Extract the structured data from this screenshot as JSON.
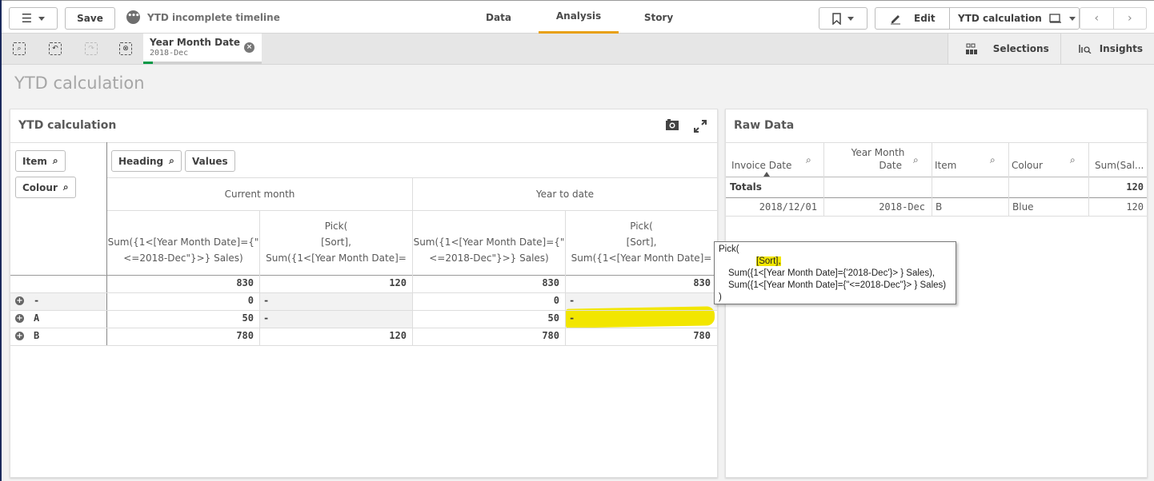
{
  "toolbar": {
    "save_label": "Save",
    "app_title": "YTD incomplete timeline",
    "tabs": [
      {
        "label": "Data"
      },
      {
        "label": "Analysis",
        "active": true
      },
      {
        "label": "Story"
      }
    ],
    "edit_label": "Edit",
    "sheet_name": "YTD calculation",
    "accent_color": "#e8a013"
  },
  "selections_bar": {
    "chip": {
      "field": "Year Month Date",
      "value": "2018-Dec",
      "selected_color": "#009845"
    },
    "selections_label": "Selections",
    "insights_label": "Insights"
  },
  "sheet": {
    "title": "YTD calculation"
  },
  "pivot": {
    "title": "YTD calculation",
    "row_dims": [
      "Item",
      "Colour"
    ],
    "col_dims": [
      "Heading",
      "Values"
    ],
    "groups": [
      "Current month",
      "Year to date"
    ],
    "measure_headers": [
      {
        "l1": "",
        "l2": "Sum({1<[Year Month Date]={\"",
        "l3": "<=2018-Dec\"}>} Sales)"
      },
      {
        "l1": "Pick(",
        "l2": "[Sort],",
        "l3": "Sum({1<[Year Month Date]="
      },
      {
        "l1": "",
        "l2": "Sum({1<[Year Month Date]={\"",
        "l3": "<=2018-Dec\"}>} Sales)"
      },
      {
        "l1": "Pick(",
        "l2": "[Sort],",
        "l3": "Sum({1<[Year Month Date]="
      }
    ],
    "totals": [
      "830",
      "120",
      "830",
      "830"
    ],
    "rows": [
      {
        "label": "-",
        "values": [
          "0",
          "-",
          "0",
          "-"
        ]
      },
      {
        "label": "A",
        "values": [
          "50",
          "-",
          "50",
          "-"
        ]
      },
      {
        "label": "B",
        "values": [
          "780",
          "120",
          "780",
          "780"
        ]
      }
    ],
    "highlight_color": "#f2e600"
  },
  "tooltip": {
    "lines": [
      "Pick(",
      "[Sort],",
      "Sum({1<[Year Month Date]={'2018-Dec'}> } Sales),",
      "Sum({1<[Year Month Date]={\"<=2018-Dec\"}> } Sales)",
      ")"
    ]
  },
  "raw": {
    "title": "Raw Data",
    "headers": [
      "Invoice Date",
      "Year Month",
      "Date",
      "Item",
      "Colour",
      "Sum(Sal..."
    ],
    "totals_label": "Totals",
    "totals_value": "120",
    "rows": [
      {
        "invoice_date": "2018/12/01",
        "ymd": "2018-Dec",
        "item": "B",
        "colour": "Blue",
        "sales": "120"
      }
    ]
  }
}
